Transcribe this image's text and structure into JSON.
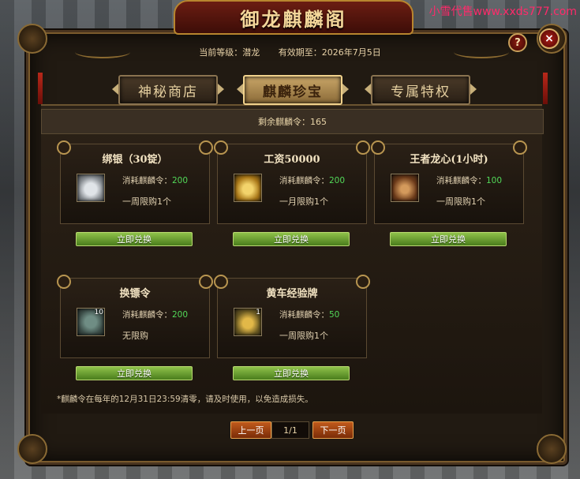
{
  "watermark": "小雪代售www.xxds777.com",
  "title": "御龙麒麟阁",
  "info": {
    "level": "当前等级：潜龙",
    "expiry": "有效期至：2026年7月5日"
  },
  "controls": {
    "help": "?",
    "close": "×"
  },
  "tabs": [
    {
      "label": "神秘商店",
      "active": false
    },
    {
      "label": "麒麟珍宝",
      "active": true
    },
    {
      "label": "专属特权",
      "active": false
    }
  ],
  "remaining": "剩余麒麟令：165",
  "cost_prefix": "消耗麒麟令：",
  "items": [
    {
      "name": "绑银（30锭）",
      "cost": "200",
      "limit": "一周限购1个",
      "icon": "silver-ingot-icon",
      "badge": "",
      "button": "立即兑换"
    },
    {
      "name": "工资50000",
      "cost": "200",
      "limit": "一月限购1个",
      "icon": "gold-salary-icon",
      "badge": "",
      "button": "立即兑换"
    },
    {
      "name": "王者龙心(1小时)",
      "cost": "100",
      "limit": "一周限购1个",
      "icon": "dragon-heart-icon",
      "badge": "",
      "button": "立即兑换"
    },
    {
      "name": "换镖令",
      "cost": "200",
      "limit": "无限购",
      "icon": "escort-token-icon",
      "badge": "10",
      "button": "立即兑换"
    },
    {
      "name": "黄车经验牌",
      "cost": "50",
      "limit": "一周限购1个",
      "icon": "yellow-cart-exp-icon",
      "badge": "1",
      "button": "立即兑换"
    }
  ],
  "note": "*麒麟令在每年的12月31日23:59清零，请及时使用，以免造成损失。",
  "pager": {
    "prev": "上一页",
    "page": "1/1",
    "next": "下一页"
  },
  "colors": {
    "accent_green": "#52d858",
    "button_green": "#6fa032",
    "pager_orange": "#b04e16"
  }
}
